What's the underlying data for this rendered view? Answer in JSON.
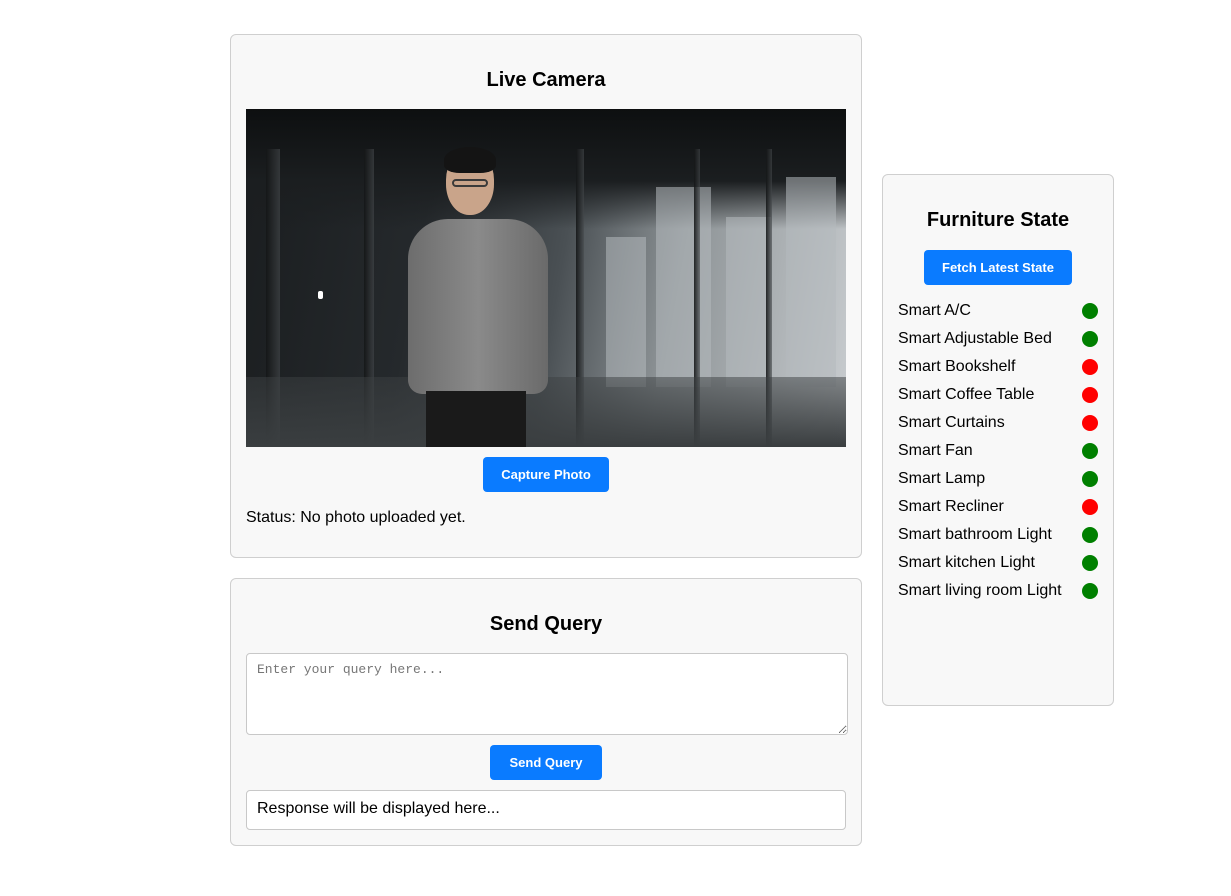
{
  "camera": {
    "title": "Live Camera",
    "capture_label": "Capture Photo",
    "status_text": "Status: No photo uploaded yet."
  },
  "query": {
    "title": "Send Query",
    "placeholder": "Enter your query here...",
    "send_label": "Send Query",
    "response_text": "Response will be displayed here..."
  },
  "furniture": {
    "title": "Furniture State",
    "fetch_label": "Fetch Latest State",
    "colors": {
      "on": "#008000",
      "off": "#ff0000"
    },
    "devices": [
      {
        "name": "Smart A/C",
        "state": "on"
      },
      {
        "name": "Smart Adjustable Bed",
        "state": "on"
      },
      {
        "name": "Smart Bookshelf",
        "state": "off"
      },
      {
        "name": "Smart Coffee Table",
        "state": "off"
      },
      {
        "name": "Smart Curtains",
        "state": "off"
      },
      {
        "name": "Smart Fan",
        "state": "on"
      },
      {
        "name": "Smart Lamp",
        "state": "on"
      },
      {
        "name": "Smart Recliner",
        "state": "off"
      },
      {
        "name": "Smart bathroom Light",
        "state": "on"
      },
      {
        "name": "Smart kitchen Light",
        "state": "on"
      },
      {
        "name": "Smart living room Light",
        "state": "on"
      }
    ]
  }
}
